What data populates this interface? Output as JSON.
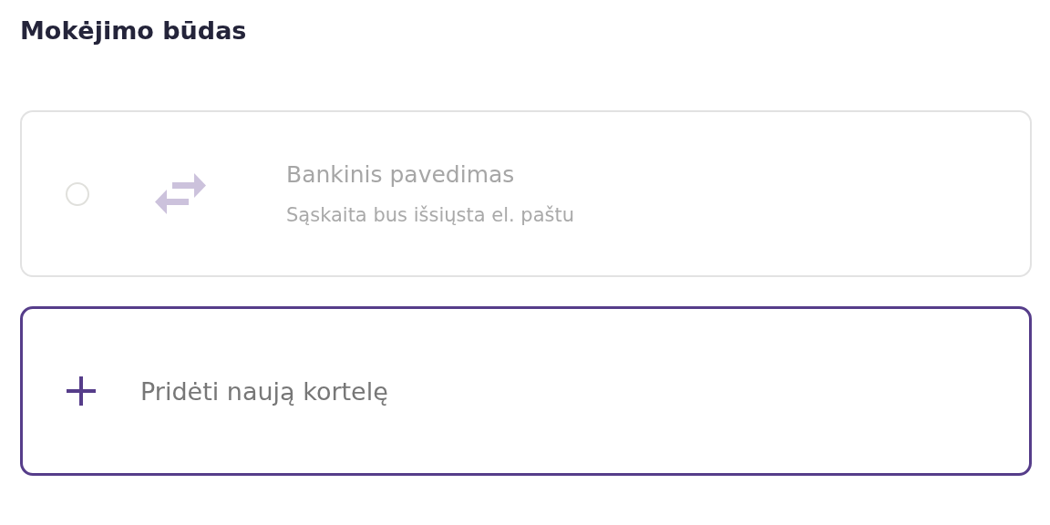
{
  "title": "Mokėjimo būdas",
  "methods": [
    {
      "kind": "bank",
      "title": "Bankinis pavedimas",
      "subtitle": "Sąskaita bus išsiųsta el. paštu",
      "selected": false,
      "disabled": true
    },
    {
      "kind": "add-card",
      "title": "Pridėti naują kortelę",
      "selected": true,
      "disabled": false
    }
  ]
}
